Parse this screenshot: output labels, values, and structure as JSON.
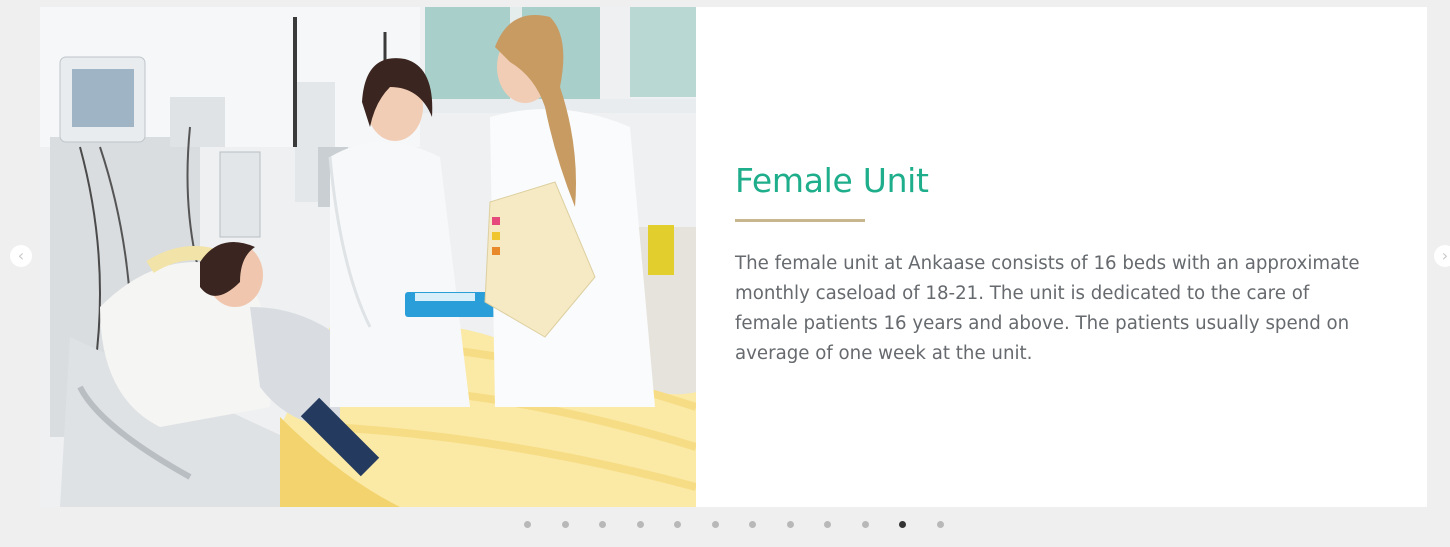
{
  "slide": {
    "title": "Female Unit",
    "description": "The female unit at Ankaase consists of 16 beds with an approximate monthly caseload of 18-21. The unit is dedicated to the care of female patients 16 years and above. The patients usually spend on average of one week at the unit.",
    "image_icon": "hospital-ward-photo"
  },
  "carousel": {
    "prev_icon": "chevron-left-icon",
    "next_icon": "chevron-right-icon",
    "dot_count": 12,
    "active_index": 10
  },
  "colors": {
    "title": "#1fae8b",
    "rule": "#c8b68e",
    "text": "#666a6e",
    "background": "#efefef",
    "dot_inactive": "#b8b8b8",
    "dot_active": "#333333"
  }
}
